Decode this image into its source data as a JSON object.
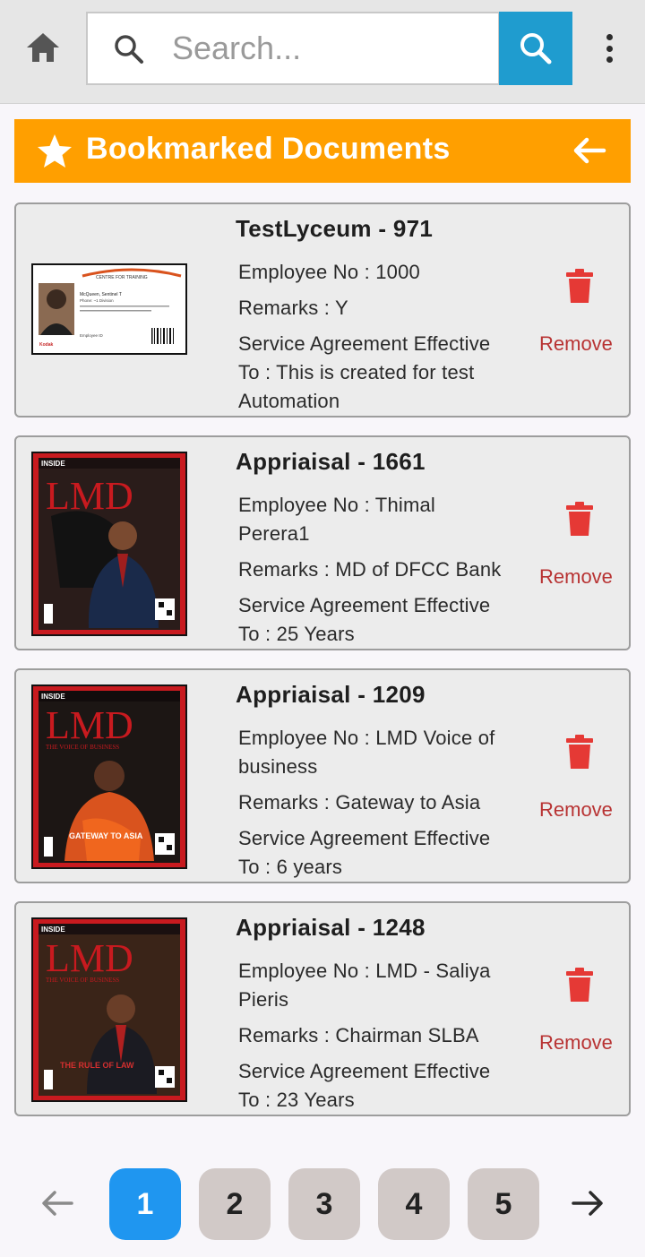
{
  "search": {
    "placeholder": "Search..."
  },
  "header": {
    "title": "Bookmarked Documents"
  },
  "documents": [
    {
      "title": "TestLyceum  -  971",
      "employee_no": "Employee No  :  1000",
      "remarks": "Remarks  :  Y",
      "service": "Service Agreement Effective To  :  This is created for test Automation",
      "remove_label": "Remove",
      "thumb": {
        "type": "id-card",
        "company": "CENTRE FOR TRAINING",
        "person": "McQueen, Sentinel T",
        "role": "Phone: ~1 Division",
        "footer": "Employee ID",
        "brand": "Kodak"
      }
    },
    {
      "title": "Appriaisal  -  1661",
      "employee_no": "Employee No  :  Thimal Perera1",
      "remarks": "Remarks  :  MD of DFCC Bank",
      "service": "Service Agreement Effective To  :  25 Years",
      "remove_label": "Remove",
      "thumb": {
        "type": "magazine",
        "inside": "INSIDE",
        "masthead": "LMD",
        "tagline": "",
        "headline": ""
      }
    },
    {
      "title": "Appriaisal  -  1209",
      "employee_no": "Employee No  :  LMD Voice of business",
      "remarks": "Remarks  :  Gateway to Asia",
      "service": "Service Agreement Effective To  :  6 years",
      "remove_label": "Remove",
      "thumb": {
        "type": "magazine",
        "inside": "INSIDE",
        "masthead": "LMD",
        "tagline": "THE VOICE OF BUSINESS",
        "headline": "GATEWAY TO ASIA"
      }
    },
    {
      "title": "Appriaisal  -  1248",
      "employee_no": "Employee No  :  LMD - Saliya Pieris",
      "remarks": "Remarks  :  Chairman SLBA",
      "service": "Service Agreement Effective To  :  23 Years",
      "remove_label": "Remove",
      "thumb": {
        "type": "magazine",
        "inside": "INSIDE",
        "masthead": "LMD",
        "tagline": "THE VOICE OF BUSINESS",
        "headline": "THE RULE OF LAW"
      }
    }
  ],
  "pagination": {
    "pages": [
      "1",
      "2",
      "3",
      "4",
      "5"
    ],
    "current": "1"
  },
  "colors": {
    "accent": "#ff9f00",
    "search_button": "#1f9ccf",
    "remove": "#b83333",
    "trash": "#e53935",
    "active_page": "#1f96f0",
    "page": "#d1c9c7"
  },
  "icons": {
    "home": "home-icon",
    "search": "search-icon",
    "menu": "more-vert-icon",
    "star": "star-icon",
    "back": "arrow-left-icon",
    "delete": "trash-icon",
    "prev": "arrow-left-icon",
    "next": "arrow-right-icon"
  }
}
